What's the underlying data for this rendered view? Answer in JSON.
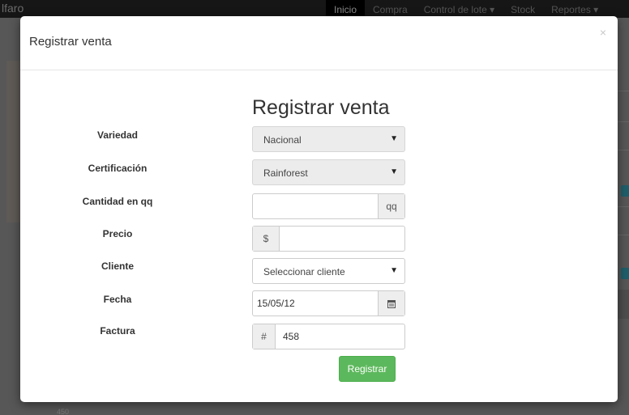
{
  "navbar": {
    "brand": "lfaro",
    "items": [
      {
        "label": "Inicio",
        "active": true
      },
      {
        "label": "Compra"
      },
      {
        "label": "Control de lote ▾"
      },
      {
        "label": "Stock"
      },
      {
        "label": "Reportes ▾"
      }
    ]
  },
  "background": {
    "bottom_text": "450"
  },
  "modal": {
    "title": "Registrar venta",
    "close": "×",
    "form_heading": "Registrar venta",
    "fields": {
      "variedad": {
        "label": "Variedad",
        "value": "Nacional"
      },
      "certificacion": {
        "label": "Certificación",
        "value": "Rainforest"
      },
      "cantidad": {
        "label": "Cantidad en qq",
        "value": "",
        "unit": "qq"
      },
      "precio": {
        "label": "Precio",
        "prefix": "$",
        "value": ""
      },
      "cliente": {
        "label": "Cliente",
        "value": "Seleccionar cliente"
      },
      "fecha": {
        "label": "Fecha",
        "value": "15/05/12",
        "icon": "calendar-icon"
      },
      "factura": {
        "label": "Factura",
        "prefix": "#",
        "value": "458"
      }
    },
    "submit_label": "Registrar",
    "submit_color": "#5cb85c"
  }
}
